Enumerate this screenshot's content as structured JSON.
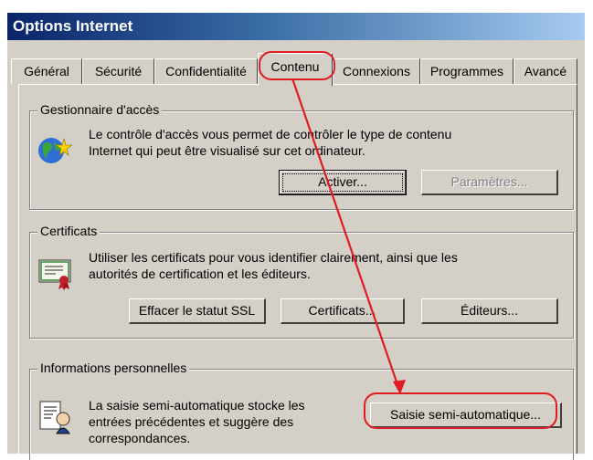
{
  "window": {
    "title": "Options Internet"
  },
  "tabs": [
    {
      "label": "Général"
    },
    {
      "label": "Sécurité"
    },
    {
      "label": "Confidentialité"
    },
    {
      "label": "Contenu"
    },
    {
      "label": "Connexions"
    },
    {
      "label": "Programmes"
    },
    {
      "label": "Avancé"
    }
  ],
  "access": {
    "title": "Gestionnaire d'accès",
    "desc1": "Le contrôle d'accès vous permet de contrôler le type de contenu",
    "desc2": "Internet qui peut être visualisé sur cet ordinateur.",
    "activate": "Activer...",
    "settings": "Paramètres..."
  },
  "certs": {
    "title": "Certificats",
    "desc1": "Utiliser les certificats pour vous identifier clairement, ainsi que les",
    "desc2": "autorités de certification et les éditeurs.",
    "clear_ssl": "Effacer le statut SSL",
    "certificates": "Certificats...",
    "publishers": "Éditeurs..."
  },
  "personal": {
    "title": "Informations personnelles",
    "desc1": "La saisie semi-automatique stocke les",
    "desc2": "entrées précédentes et suggère des",
    "desc3": "correspondances.",
    "autocomplete": "Saisie semi-automatique..."
  },
  "colors": {
    "titlebar": "#0a246a",
    "annotation": "#e11b22",
    "dialog": "#d4d0c8"
  }
}
